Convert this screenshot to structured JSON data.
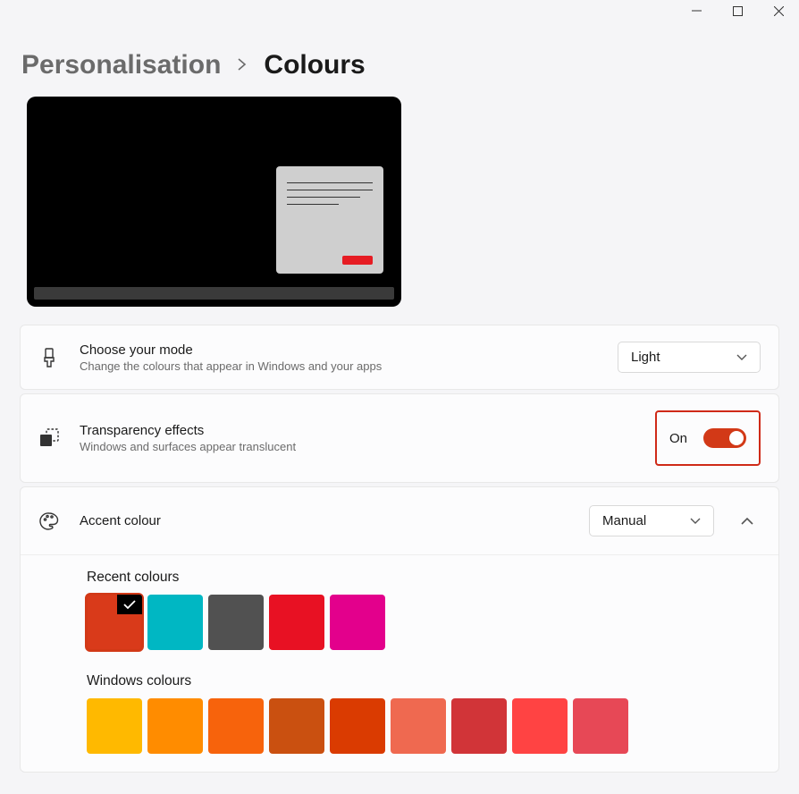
{
  "breadcrumb": {
    "parent": "Personalisation",
    "current": "Colours"
  },
  "mode": {
    "title": "Choose your mode",
    "subtitle": "Change the colours that appear in Windows and your apps",
    "selected": "Light"
  },
  "transparency": {
    "title": "Transparency effects",
    "subtitle": "Windows and surfaces appear translucent",
    "state_label": "On",
    "state": true
  },
  "accent": {
    "title": "Accent colour",
    "mode_selected": "Manual",
    "recent_label": "Recent colours",
    "recent": [
      "#d93a1a",
      "#00b7c3",
      "#515151",
      "#e81123",
      "#e3008c"
    ],
    "selected_recent_index": 0,
    "windows_label": "Windows colours",
    "windows": [
      "#ffb900",
      "#ff8c00",
      "#f7630c",
      "#ca5010",
      "#da3b01",
      "#ef6950",
      "#d13438",
      "#ff4343",
      "#e74856"
    ]
  }
}
